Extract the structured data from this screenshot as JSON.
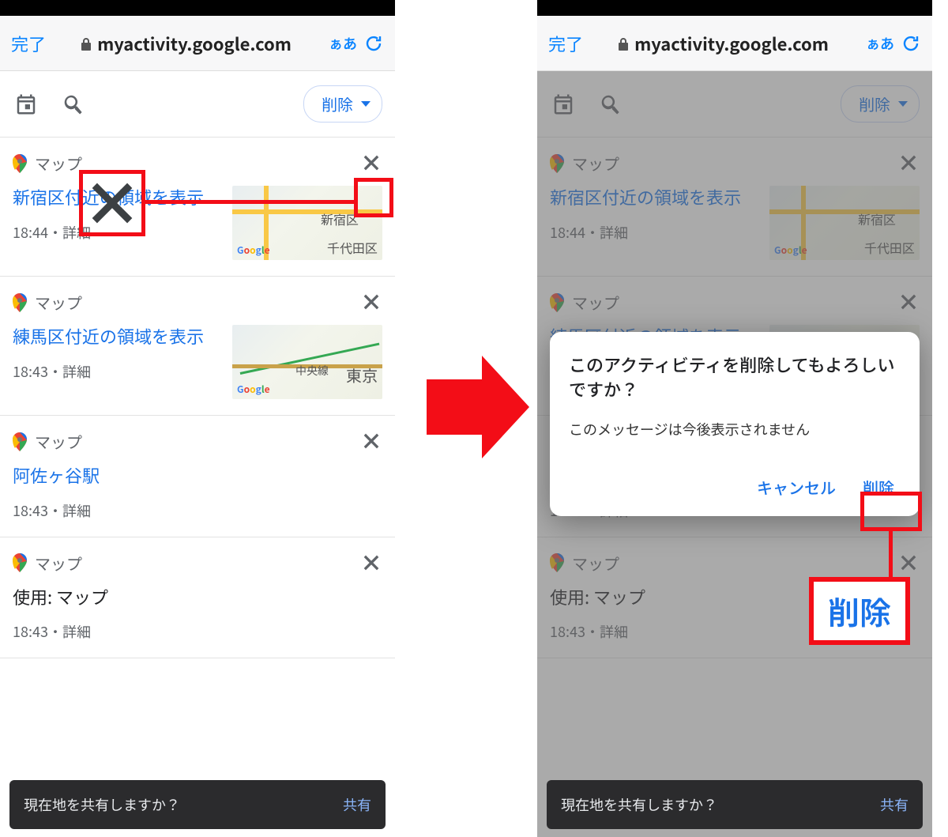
{
  "browser": {
    "done": "完了",
    "url": "myactivity.google.com",
    "aa": "ぁあ"
  },
  "toolbar": {
    "delete_label": "削除"
  },
  "cards": [
    {
      "app": "マップ",
      "title": "新宿区付近の領域を表示",
      "meta": "18:44・詳細",
      "thumb_label_1": "新宿区",
      "thumb_label_2": "千代田区",
      "has_thumb": true,
      "link_style": true
    },
    {
      "app": "マップ",
      "title": "練馬区付近の領域を表示",
      "meta": "18:43・詳細",
      "thumb_label_1": "中央線",
      "thumb_label_2": "東京",
      "has_thumb": true,
      "link_style": true
    },
    {
      "app": "マップ",
      "title": "阿佐ヶ谷駅",
      "meta": "18:43・詳細",
      "has_thumb": false,
      "link_style": true
    },
    {
      "app": "マップ",
      "title": "使用: マップ",
      "meta": "18:43・詳細",
      "has_thumb": false,
      "link_style": false
    }
  ],
  "dialog": {
    "title": "このアクティビティを削除してもよろしいですか？",
    "message": "このメッセージは今後表示されません",
    "cancel": "キャンセル",
    "confirm": "削除"
  },
  "snackbar": {
    "text": "現在地を共有しますか？",
    "action": "共有"
  },
  "callout": {
    "delete": "削除"
  }
}
